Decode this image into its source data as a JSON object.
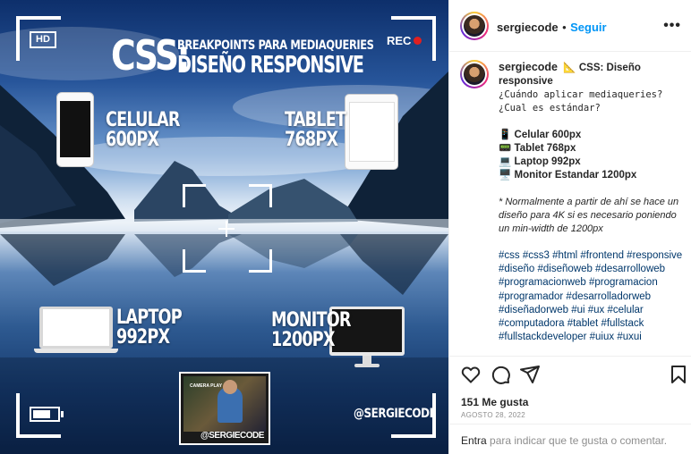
{
  "image": {
    "hd_label": "HD",
    "rec_label": "REC",
    "title_big": "CSS:",
    "title_line1": "BREAKPOINTS PARA MEDIAQUERIES",
    "title_line2": "DISEÑO RESPONSIVE",
    "devices": {
      "phone": {
        "name": "CELULAR",
        "size": "600PX"
      },
      "tablet": {
        "name": "TABLET",
        "size": "768PX"
      },
      "laptop": {
        "name": "LAPTOP",
        "size": "992PX"
      },
      "monitor": {
        "name": "MONITOR",
        "size": "1200PX"
      }
    },
    "thumb_text": "CAMERA PLAY",
    "thumb_handle": "@SERGIECODE",
    "handle": "@SERGIECODE"
  },
  "header": {
    "username": "sergiecode",
    "separator": "•",
    "follow_label": "Seguir",
    "more_label": "•••"
  },
  "caption": {
    "username": "sergiecode",
    "title": "📐 CSS: Diseño responsive",
    "question": "¿Cuándo aplicar mediaqueries? ¿Cual es estándar?",
    "list": [
      {
        "icon": "📱",
        "text": "Celular 600px"
      },
      {
        "icon": "📟",
        "text": "Tablet 768px"
      },
      {
        "icon": "💻",
        "text": "Laptop 992px"
      },
      {
        "icon": "🖥️",
        "text": "Monitor Estandar 1200px"
      }
    ],
    "note": "* Normalmente a partir de ahí se hace un diseño para 4K si es necesario poniendo un min-width de 1200px",
    "hashtags": "#css #css3 #html #frontend #responsive #diseño #diseñoweb #desarrolloweb #programacionweb #programacion #programador #desarrolladorweb #diseñadorweb #ui #ux #celular #computadora #tablet #fullstack #fullstackdeveloper #uiux #uxui"
  },
  "stats": {
    "likes": "151 Me gusta",
    "date": "AGOSTO 28, 2022"
  },
  "comment": {
    "prompt_link": "Entra",
    "prompt_rest": " para indicar que te gusta o comentar."
  },
  "colors": {
    "follow_blue": "#0095f6",
    "hashtag_blue": "#00376b",
    "muted_gray": "#8e8e8e",
    "rec_red": "#e02020"
  },
  "icons": {
    "actions": [
      "heart-icon",
      "comment-icon",
      "share-icon",
      "bookmark-icon"
    ]
  }
}
